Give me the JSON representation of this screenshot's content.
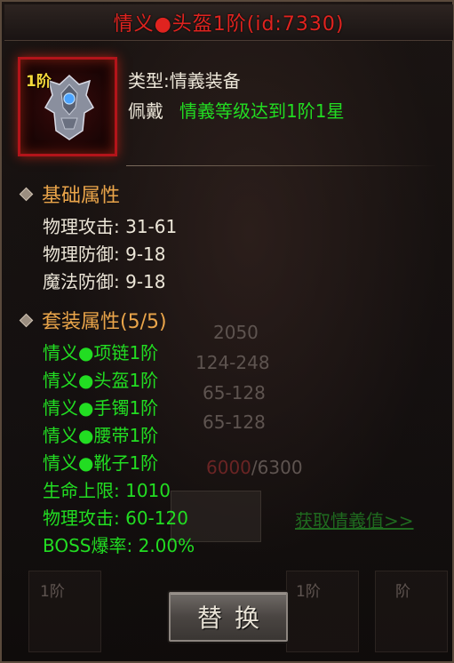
{
  "title": "情义●头盔1阶(id:7330)",
  "item": {
    "tier_badge": "1阶",
    "icon": "helmet-icon",
    "type_label": "类型:",
    "type_value": "情義装备",
    "wear_label": "佩戴",
    "wear_value": "情義等级达到1阶1星"
  },
  "base_attributes": {
    "heading": "基础属性",
    "stats": [
      "物理攻击: 31-61",
      "物理防御: 9-18",
      "魔法防御: 9-18"
    ]
  },
  "set_attributes": {
    "heading": "套装属性(5/5)",
    "pieces": [
      "情义●项链1阶",
      "情义●头盔1阶",
      "情义●手镯1阶",
      "情义●腰带1阶",
      "情义●靴子1阶"
    ],
    "bonuses": [
      "生命上限: 1010",
      "物理攻击: 60-120",
      "BOSS爆率: 2.00%"
    ]
  },
  "background": {
    "values": [
      "2050",
      "124-248",
      "65-128",
      "65-128"
    ],
    "progress_current": "6000",
    "progress_total": "/6300",
    "link": "获取情義值>>",
    "slot_labels": [
      "1阶",
      "1阶",
      "阶"
    ]
  },
  "buttons": {
    "swap": "替换"
  },
  "colors": {
    "title": "#e0231f",
    "green": "#22dd22",
    "heading": "#eaa54a"
  }
}
